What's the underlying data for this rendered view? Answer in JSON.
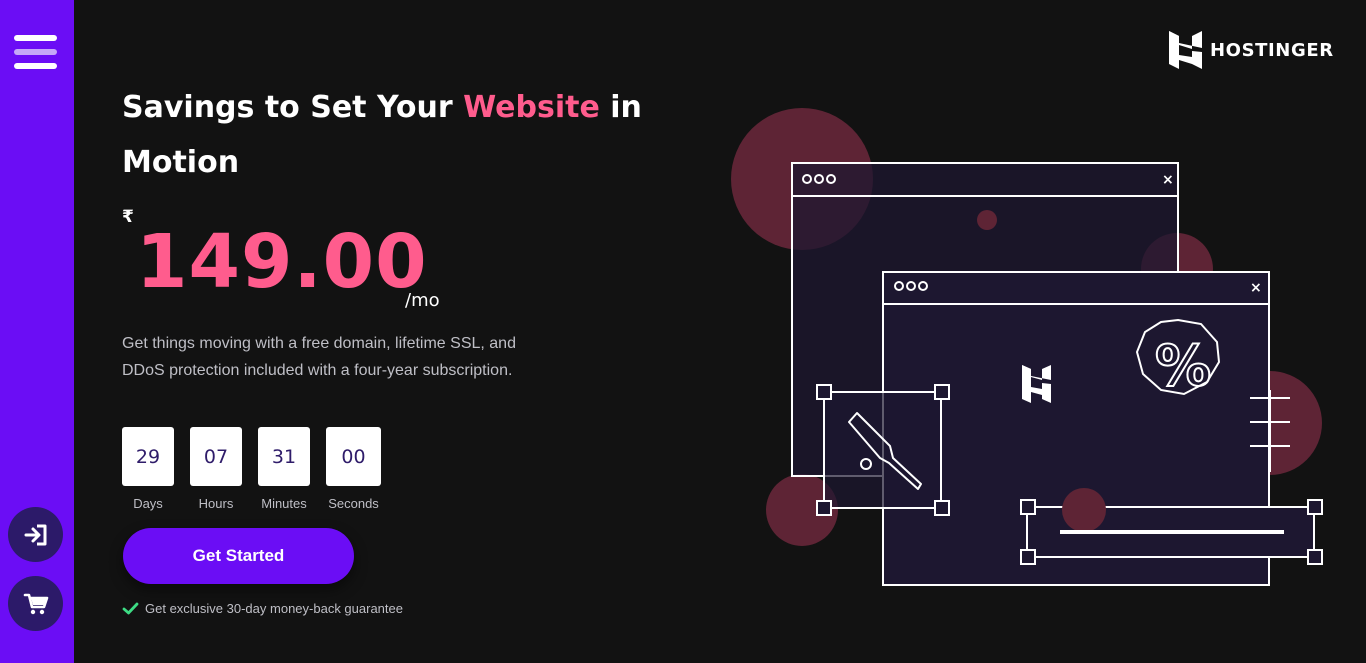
{
  "brand": {
    "name": "HOSTINGER",
    "accent_color": "#ff5c8d",
    "primary_color": "#6b0df5"
  },
  "sidebar": {
    "menu_icon": "hamburger-menu-icon",
    "login_icon": "sign-in-icon",
    "cart_icon": "shopping-cart-icon"
  },
  "hero": {
    "title_part1": "Savings to Set Your ",
    "title_highlight": "Website",
    "title_part2": " in Motion",
    "currency": "₹",
    "price": "149.00",
    "period": "/mo",
    "description": "Get things moving with a free domain, lifetime SSL, and DDoS protection included with a four-year subscription."
  },
  "countdown": [
    {
      "value": "29",
      "label": "Days"
    },
    {
      "value": "07",
      "label": "Hours"
    },
    {
      "value": "31",
      "label": "Minutes"
    },
    {
      "value": "00",
      "label": "Seconds"
    }
  ],
  "cta": {
    "label": "Get Started"
  },
  "guarantee": {
    "icon": "check-icon",
    "text": "Get exclusive 30-day money-back guarantee"
  },
  "illustration": {
    "percent_symbol": "%",
    "close_symbol": "×"
  }
}
